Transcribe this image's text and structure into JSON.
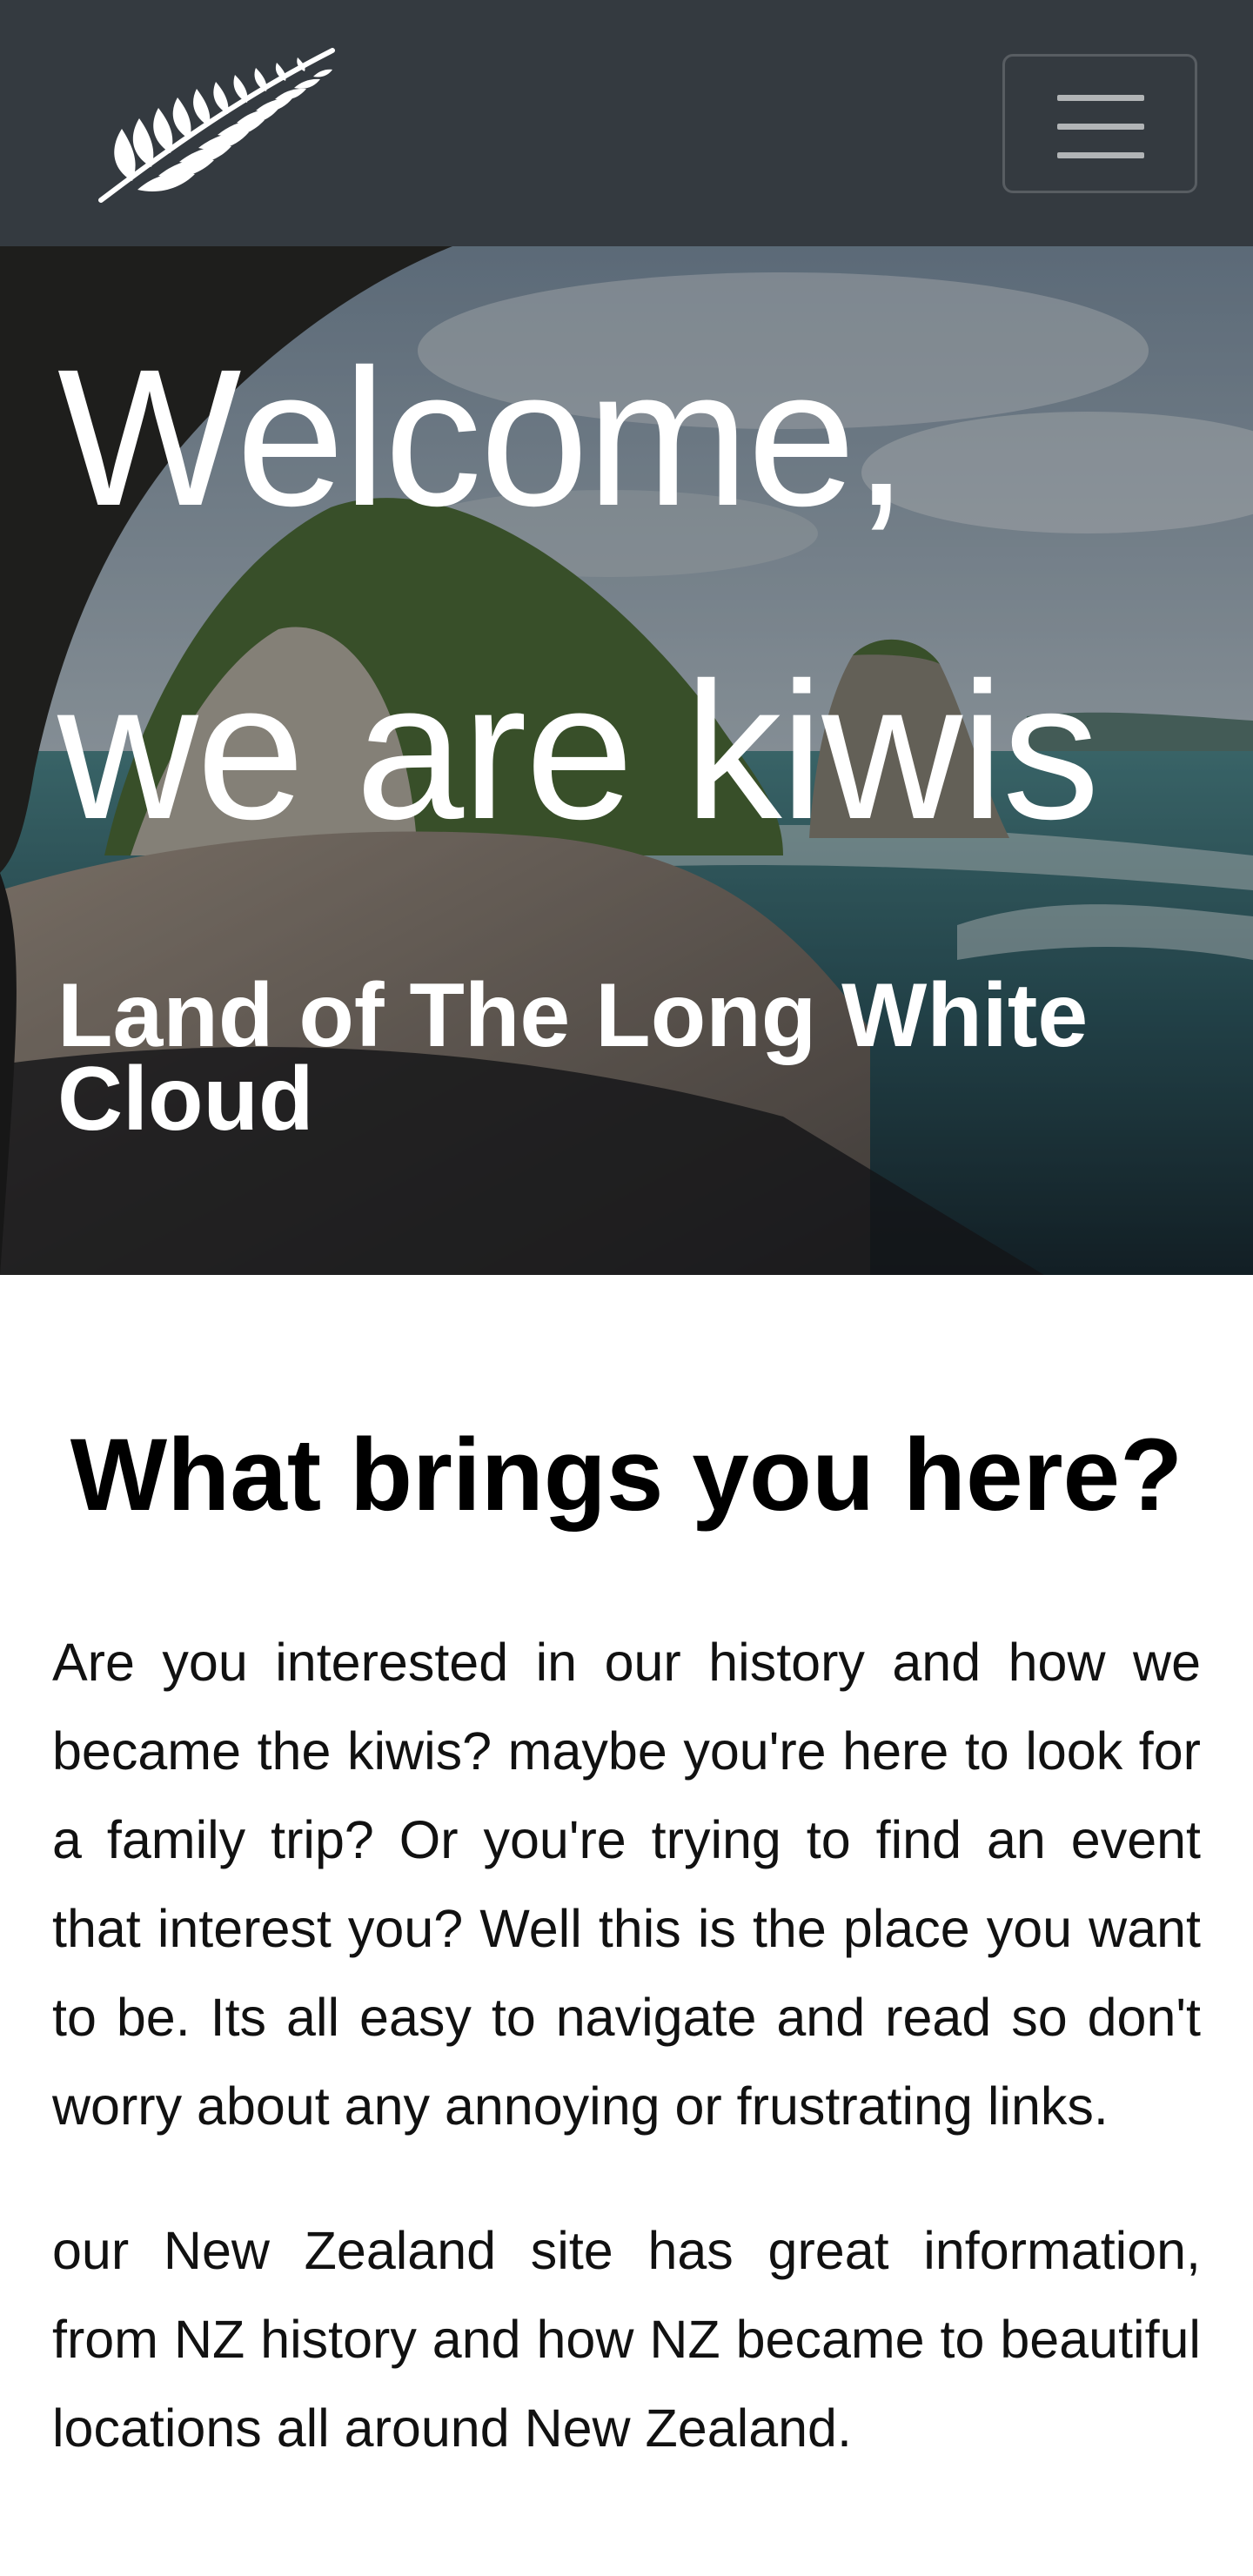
{
  "navbar": {
    "logo_icon": "silver-fern-icon",
    "menu_icon": "hamburger-icon",
    "background_color": "#343a40"
  },
  "hero": {
    "title_line1": "Welcome,",
    "title_line2": "we are kiwis",
    "subtitle": "Land of The Long White Cloud"
  },
  "intro": {
    "heading": "What brings you here?",
    "paragraph1": "Are you interested in our history and how we became the kiwis? maybe you're here to look for a family trip? Or you're trying to find an event that interest you? Well this is the place you want to be. Its all easy to navigate and read so don't worry about any annoying or frustrating links.",
    "paragraph2": "our New Zealand site has great information, from NZ history and how NZ became to beautiful locations all around New Zealand."
  }
}
